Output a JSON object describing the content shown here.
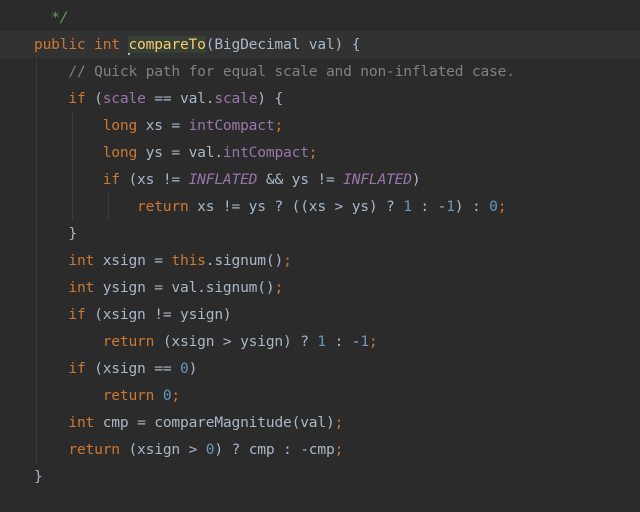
{
  "editor": {
    "current_line": 1,
    "lines": [
      {
        "indent": 0,
        "guides": 0,
        "tokens": [
          [
            "doc",
            "  */"
          ]
        ]
      },
      {
        "indent": 0,
        "guides": 0,
        "tokens": [
          [
            "kw",
            "public int "
          ],
          [
            "caret",
            ""
          ],
          [
            "decl",
            "compareTo"
          ],
          [
            "plain",
            "(BigDecimal val) {"
          ]
        ]
      },
      {
        "indent": 1,
        "guides": 1,
        "tokens": [
          [
            "comment",
            "// Quick path for equal scale and non-inflated case."
          ]
        ]
      },
      {
        "indent": 1,
        "guides": 1,
        "tokens": [
          [
            "kw",
            "if "
          ],
          [
            "plain",
            "("
          ],
          [
            "field",
            "scale"
          ],
          [
            "plain",
            " == val."
          ],
          [
            "field",
            "scale"
          ],
          [
            "plain",
            ") {"
          ]
        ]
      },
      {
        "indent": 2,
        "guides": 2,
        "tokens": [
          [
            "kw",
            "long "
          ],
          [
            "plain",
            "xs = "
          ],
          [
            "field",
            "intCompact"
          ],
          [
            "kw",
            ";"
          ]
        ]
      },
      {
        "indent": 2,
        "guides": 2,
        "tokens": [
          [
            "kw",
            "long "
          ],
          [
            "plain",
            "ys = val."
          ],
          [
            "field",
            "intCompact"
          ],
          [
            "kw",
            ";"
          ]
        ]
      },
      {
        "indent": 2,
        "guides": 2,
        "tokens": [
          [
            "kw",
            "if "
          ],
          [
            "plain",
            "(xs != "
          ],
          [
            "static",
            "INFLATED"
          ],
          [
            "plain",
            " && ys != "
          ],
          [
            "static",
            "INFLATED"
          ],
          [
            "plain",
            ")"
          ]
        ]
      },
      {
        "indent": 3,
        "guides": 3,
        "tokens": [
          [
            "kw",
            "return "
          ],
          [
            "plain",
            "xs != ys ? ((xs > ys) ? "
          ],
          [
            "num",
            "1"
          ],
          [
            "plain",
            " : -"
          ],
          [
            "num",
            "1"
          ],
          [
            "plain",
            ") : "
          ],
          [
            "num",
            "0"
          ],
          [
            "kw",
            ";"
          ]
        ]
      },
      {
        "indent": 1,
        "guides": 1,
        "tokens": [
          [
            "plain",
            "}"
          ]
        ]
      },
      {
        "indent": 1,
        "guides": 1,
        "tokens": [
          [
            "kw",
            "int "
          ],
          [
            "plain",
            "xsign = "
          ],
          [
            "kw",
            "this"
          ],
          [
            "plain",
            ".signum()"
          ],
          [
            "kw",
            ";"
          ]
        ]
      },
      {
        "indent": 1,
        "guides": 1,
        "tokens": [
          [
            "kw",
            "int "
          ],
          [
            "plain",
            "ysign = val.signum()"
          ],
          [
            "kw",
            ";"
          ]
        ]
      },
      {
        "indent": 1,
        "guides": 1,
        "tokens": [
          [
            "kw",
            "if "
          ],
          [
            "plain",
            "(xsign != ysign)"
          ]
        ]
      },
      {
        "indent": 2,
        "guides": 1,
        "tokens": [
          [
            "kw",
            "return "
          ],
          [
            "plain",
            "(xsign > ysign) ? "
          ],
          [
            "num",
            "1"
          ],
          [
            "plain",
            " : -"
          ],
          [
            "num",
            "1"
          ],
          [
            "kw",
            ";"
          ]
        ]
      },
      {
        "indent": 1,
        "guides": 1,
        "tokens": [
          [
            "kw",
            "if "
          ],
          [
            "plain",
            "(xsign == "
          ],
          [
            "num",
            "0"
          ],
          [
            "plain",
            ")"
          ]
        ]
      },
      {
        "indent": 2,
        "guides": 1,
        "tokens": [
          [
            "kw",
            "return "
          ],
          [
            "num",
            "0"
          ],
          [
            "kw",
            ";"
          ]
        ]
      },
      {
        "indent": 1,
        "guides": 1,
        "tokens": [
          [
            "kw",
            "int "
          ],
          [
            "plain",
            "cmp = compareMagnitude(val)"
          ],
          [
            "kw",
            ";"
          ]
        ]
      },
      {
        "indent": 1,
        "guides": 1,
        "tokens": [
          [
            "kw",
            "return "
          ],
          [
            "plain",
            "(xsign > "
          ],
          [
            "num",
            "0"
          ],
          [
            "plain",
            ") ? cmp : -cmp"
          ],
          [
            "kw",
            ";"
          ]
        ]
      },
      {
        "indent": 0,
        "guides": 0,
        "tokens": [
          [
            "plain",
            "}"
          ]
        ]
      }
    ]
  }
}
